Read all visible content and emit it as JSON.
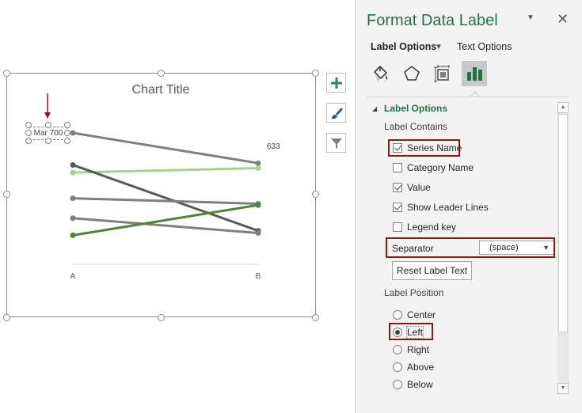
{
  "chart": {
    "title": "Chart Title",
    "selected_label_text": "Mar 700",
    "end_value_label": "633"
  },
  "chart_data": {
    "type": "line",
    "x": [
      "A",
      "B"
    ],
    "series": [
      {
        "values": [
          700,
          633
        ],
        "color": "#7f7f7f"
      },
      {
        "values": [
          612,
          622
        ],
        "color": "#a9d08e"
      },
      {
        "values": [
          629,
          483
        ],
        "color": "#595959"
      },
      {
        "values": [
          555,
          543
        ],
        "color": "#7f7f7f"
      },
      {
        "values": [
          511,
          478
        ],
        "color": "#7f7f7f"
      },
      {
        "values": [
          473,
          540
        ],
        "color": "#548235"
      }
    ],
    "title": "Chart Title",
    "grid": false,
    "legend": "none"
  },
  "chart_buttons": [
    {
      "icon": "plus-icon"
    },
    {
      "icon": "brush-icon"
    },
    {
      "icon": "filter-icon"
    }
  ],
  "panel": {
    "title": "Format Data Label",
    "dropdown_glyph": "▼",
    "close_glyph": "✕",
    "tabs": {
      "label_options": "Label Options",
      "label_arrow": "▼",
      "text_options": "Text Options"
    },
    "section_arrow": "◢",
    "section_title": "Label Options",
    "label_contains_heading": "Label Contains",
    "checkboxes": [
      {
        "label": "Series Name",
        "checked": true
      },
      {
        "label": "Category Name",
        "checked": false
      },
      {
        "label": "Value",
        "checked": true
      },
      {
        "label": "Show Leader Lines",
        "checked": true
      },
      {
        "label": "Legend key",
        "checked": false
      }
    ],
    "separator": {
      "label": "Separator",
      "value": "(space)",
      "arrow": "▼"
    },
    "reset_button": "Reset Label Text",
    "label_position_heading": "Label Position",
    "positions": [
      {
        "label": "Center",
        "checked": false
      },
      {
        "label": "Left",
        "checked": true
      },
      {
        "label": "Right",
        "checked": false
      },
      {
        "label": "Above",
        "checked": false
      },
      {
        "label": "Below",
        "checked": false
      }
    ],
    "scroll_up": "▲",
    "scroll_down": "▼"
  },
  "colors": {
    "accent": "#217346",
    "highlight_box": "#8b1a1a",
    "arrow": "#8b1a1a"
  }
}
